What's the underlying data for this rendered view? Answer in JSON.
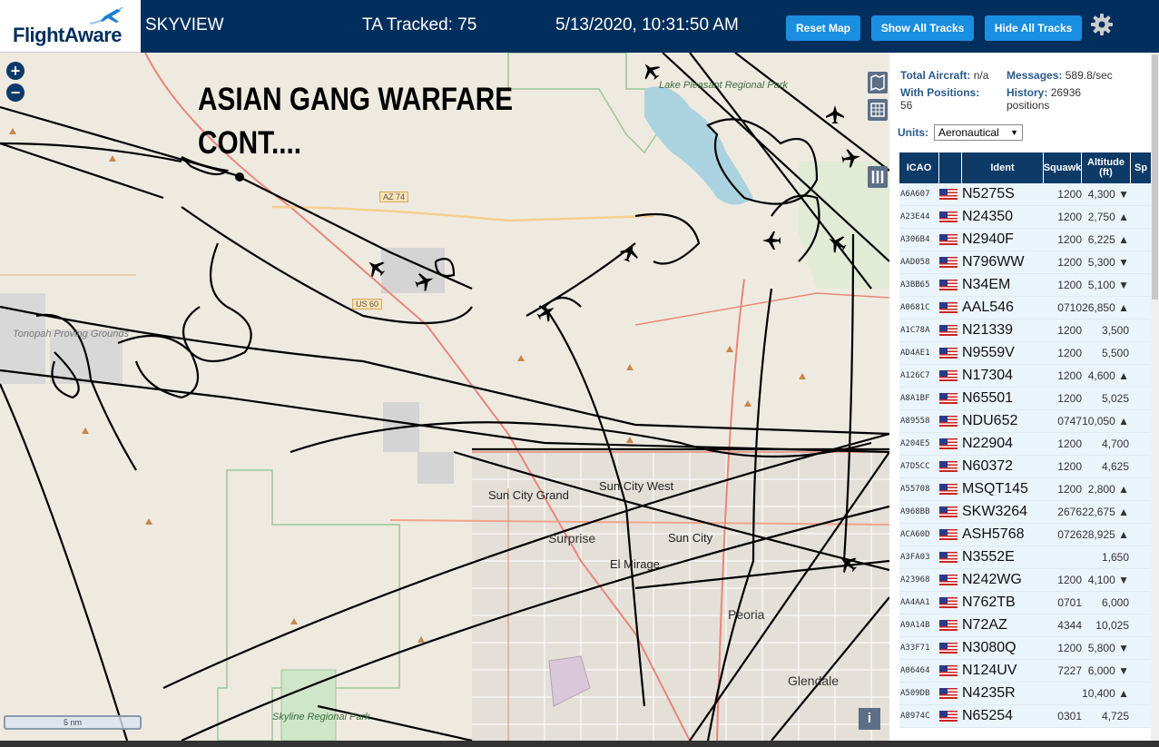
{
  "header": {
    "logo": "FlightAware",
    "app_title": "SKYVIEW",
    "ta_tracked": "TA Tracked: 75",
    "datetime": "5/13/2020, 10:31:50 AM",
    "reset_map": "Reset Map",
    "show_all_tracks": "Show All Tracks",
    "hide_all_tracks": "Hide All Tracks",
    "gear_icon": "gear-icon"
  },
  "map": {
    "overlay_line1": "ASIAN GANG WARFARE",
    "overlay_line2": "CONT....",
    "scale": "5 nm",
    "info": "i",
    "zoom_in": "+",
    "zoom_out": "−",
    "labels": {
      "lake": "Lake Pleasant Regional Park",
      "tonopah": "Tonopah Proving Grounds",
      "sun_city_grand": "Sun City Grand",
      "sun_city_west": "Sun City West",
      "surprise": "Surprise",
      "sun_city": "Sun City",
      "el_mirage": "El Mirage",
      "peoria": "Peoria",
      "glendale": "Glendale",
      "skyline": "Skyline Regional Park",
      "az74": "AZ 74",
      "us60": "US 60"
    }
  },
  "panel": {
    "total_aircraft_label": "Total Aircraft:",
    "total_aircraft_value": "n/a",
    "with_positions_label": "With Positions:",
    "with_positions_value": "56",
    "messages_label": "Messages:",
    "messages_value": "589.8/sec",
    "history_label": "History:",
    "history_value": "26936",
    "history_unit": "positions",
    "units_label": "Units:",
    "units_value": "Aeronautical",
    "columns": [
      "ICAO",
      "Ident",
      "Squawk",
      "Altitude (ft)",
      "Sp"
    ],
    "rows": [
      {
        "icao": "A6A607",
        "ident": "N5275S",
        "squawk": "1200",
        "alt": "4,300 ▼"
      },
      {
        "icao": "A23E44",
        "ident": "N24350",
        "squawk": "1200",
        "alt": "2,750 ▲"
      },
      {
        "icao": "A306B4",
        "ident": "N2940F",
        "squawk": "1200",
        "alt": "6,225 ▲"
      },
      {
        "icao": "AAD058",
        "ident": "N796WW",
        "squawk": "1200",
        "alt": "5,300 ▼"
      },
      {
        "icao": "A3BB65",
        "ident": "N34EM",
        "squawk": "1200",
        "alt": "5,100 ▼"
      },
      {
        "icao": "A0681C",
        "ident": "AAL546",
        "squawk": "0710",
        "alt": "26,850 ▲"
      },
      {
        "icao": "A1C78A",
        "ident": "N21339",
        "squawk": "1200",
        "alt": "3,500"
      },
      {
        "icao": "AD4AE1",
        "ident": "N9559V",
        "squawk": "1200",
        "alt": "5,500"
      },
      {
        "icao": "A126C7",
        "ident": "N17304",
        "squawk": "1200",
        "alt": "4,600 ▲"
      },
      {
        "icao": "A8A1BF",
        "ident": "N65501",
        "squawk": "1200",
        "alt": "5,025"
      },
      {
        "icao": "A89558",
        "ident": "NDU652",
        "squawk": "0747",
        "alt": "10,050 ▲"
      },
      {
        "icao": "A204E5",
        "ident": "N22904",
        "squawk": "1200",
        "alt": "4,700"
      },
      {
        "icao": "A7D5CC",
        "ident": "N60372",
        "squawk": "1200",
        "alt": "4,625"
      },
      {
        "icao": "A55708",
        "ident": "MSQT145",
        "squawk": "1200",
        "alt": "2,800 ▲"
      },
      {
        "icao": "A968BB",
        "ident": "SKW3264",
        "squawk": "2676",
        "alt": "22,675 ▲"
      },
      {
        "icao": "ACA60D",
        "ident": "ASH5768",
        "squawk": "0726",
        "alt": "28,925 ▲"
      },
      {
        "icao": "A3FA03",
        "ident": "N3552E",
        "squawk": "",
        "alt": "1,650"
      },
      {
        "icao": "A23968",
        "ident": "N242WG",
        "squawk": "1200",
        "alt": "4,100 ▼"
      },
      {
        "icao": "AA4AA1",
        "ident": "N762TB",
        "squawk": "0701",
        "alt": "6,000"
      },
      {
        "icao": "A9A14B",
        "ident": "N72AZ",
        "squawk": "4344",
        "alt": "10,025"
      },
      {
        "icao": "A33F71",
        "ident": "N3080Q",
        "squawk": "1200",
        "alt": "5,800 ▼"
      },
      {
        "icao": "A06464",
        "ident": "N124UV",
        "squawk": "7227",
        "alt": "6,000 ▼"
      },
      {
        "icao": "A509DB",
        "ident": "N4235R",
        "squawk": "",
        "alt": "10,400 ▲"
      },
      {
        "icao": "A8974C",
        "ident": "N65254",
        "squawk": "0301",
        "alt": "4,725"
      }
    ]
  }
}
